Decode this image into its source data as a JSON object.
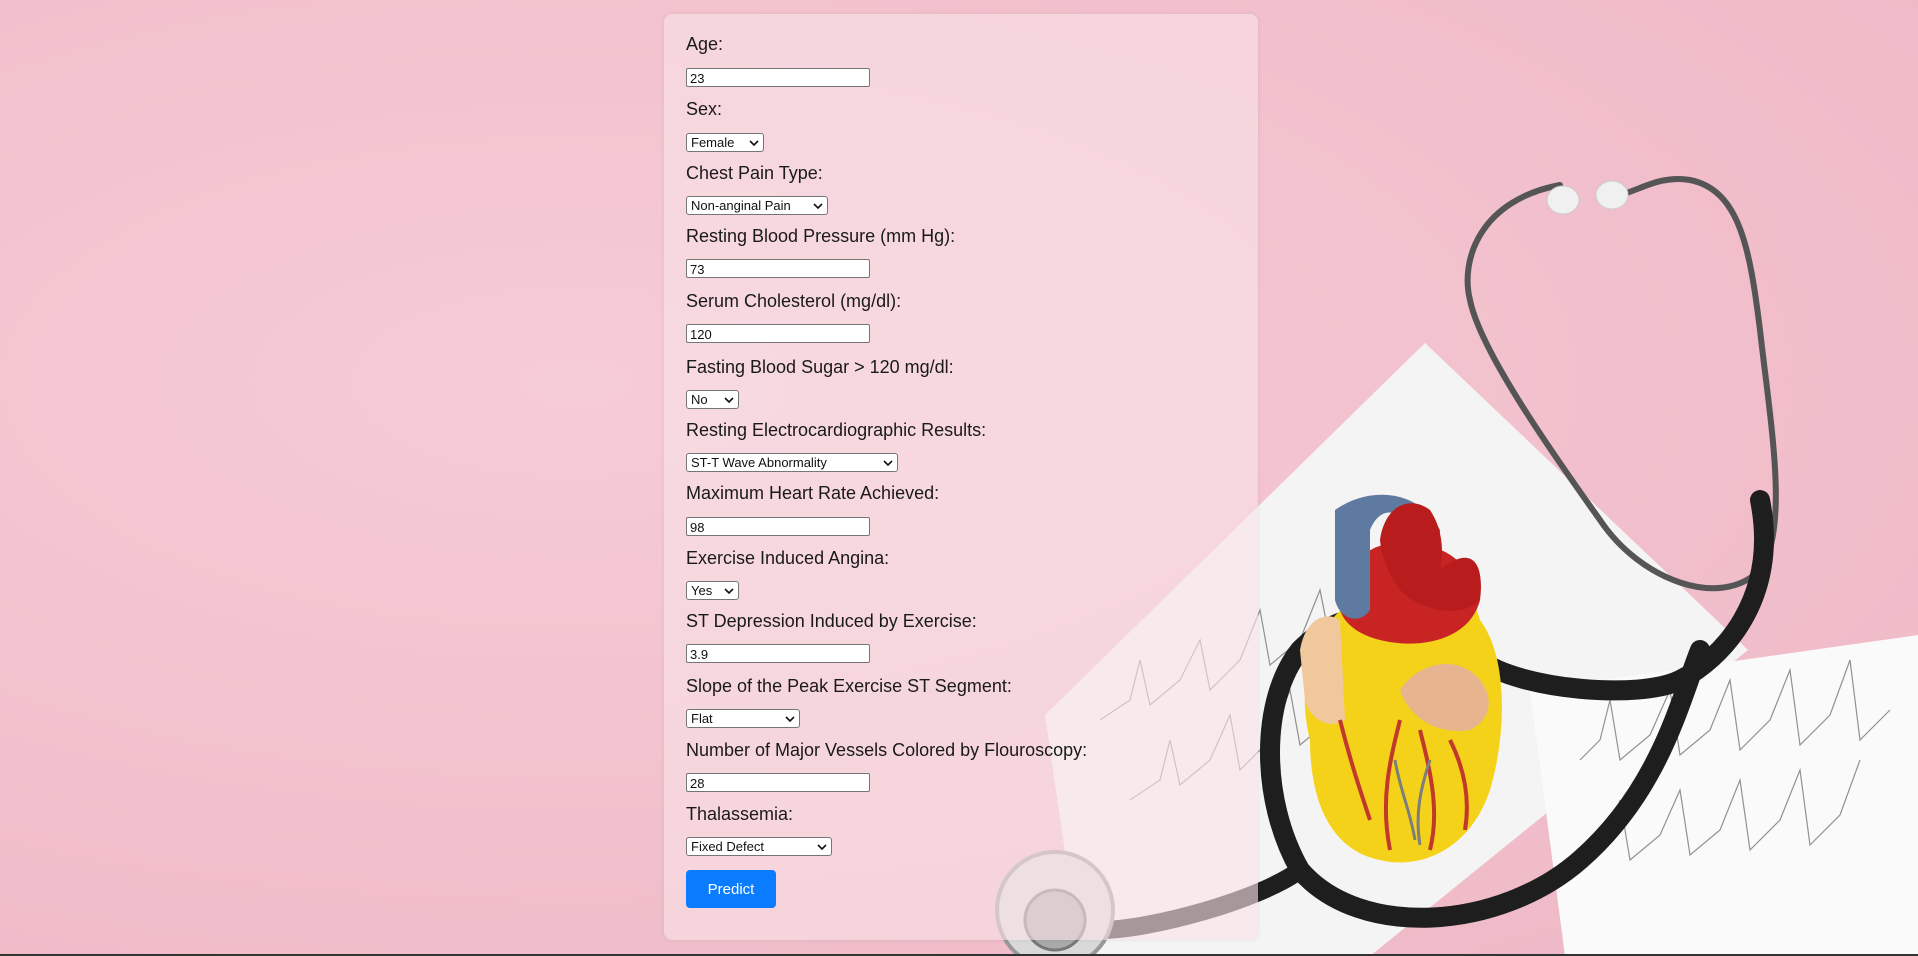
{
  "form": {
    "age": {
      "label": "Age:",
      "value": "23"
    },
    "sex": {
      "label": "Sex:",
      "value": "Female"
    },
    "chest_pain": {
      "label": "Chest Pain Type:",
      "value": "Non-anginal Pain"
    },
    "resting_bp": {
      "label": "Resting Blood Pressure (mm Hg):",
      "value": "73"
    },
    "cholesterol": {
      "label": "Serum Cholesterol (mg/dl):",
      "value": "120"
    },
    "fasting_sugar": {
      "label": "Fasting Blood Sugar > 120 mg/dl:",
      "value": "No"
    },
    "rest_ecg": {
      "label": "Resting Electrocardiographic Results:",
      "value": "ST-T Wave Abnormality"
    },
    "max_hr": {
      "label": "Maximum Heart Rate Achieved:",
      "value": "98"
    },
    "exercise_angina": {
      "label": "Exercise Induced Angina:",
      "value": "Yes"
    },
    "st_depression": {
      "label": "ST Depression Induced by Exercise:",
      "value": "3.9"
    },
    "slope": {
      "label": "Slope of the Peak Exercise ST Segment:",
      "value": "Flat"
    },
    "vessels": {
      "label": "Number of Major Vessels Colored by Flouroscopy:",
      "value": "28"
    },
    "thalassemia": {
      "label": "Thalassemia:",
      "value": "Fixed Defect"
    },
    "submit_label": "Predict"
  },
  "colors": {
    "background": "#f2c3ce",
    "button": "#0a7cff"
  },
  "background_image": "stethoscope-heart-ecg-image"
}
